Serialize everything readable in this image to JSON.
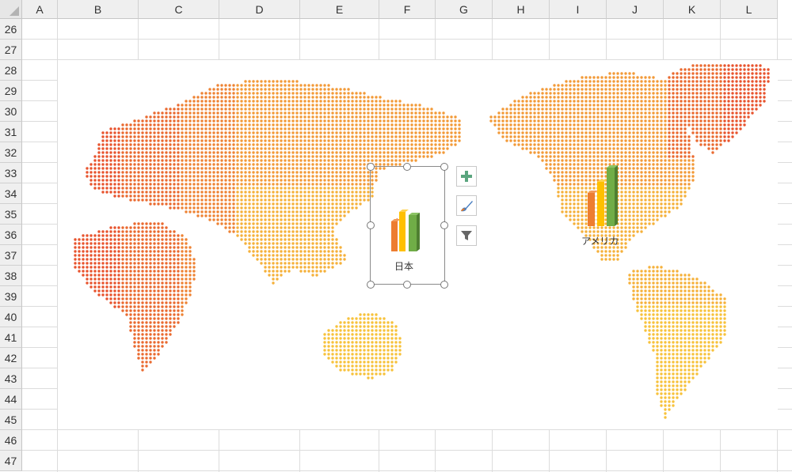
{
  "columns": [
    "A",
    "B",
    "C",
    "D",
    "E",
    "F",
    "G",
    "H",
    "I",
    "J",
    "K",
    "L"
  ],
  "rows": [
    "26",
    "27",
    "28",
    "29",
    "30",
    "31",
    "32",
    "33",
    "34",
    "35",
    "36",
    "37",
    "38",
    "39",
    "40",
    "41",
    "42",
    "43",
    "44",
    "45",
    "46",
    "47"
  ],
  "map": {
    "countries": [
      {
        "name": "日本"
      },
      {
        "name": "アメリカ"
      }
    ]
  },
  "chart_buttons": [
    {
      "icon": "plus-icon"
    },
    {
      "icon": "brush-icon"
    },
    {
      "icon": "filter-icon"
    }
  ],
  "colors": {
    "bar_orange": "#ed7d31",
    "bar_yellow": "#ffc000",
    "bar_green": "#70ad47",
    "map_dot_red": "#e04a2a",
    "map_dot_yellow": "#f7c23c"
  }
}
